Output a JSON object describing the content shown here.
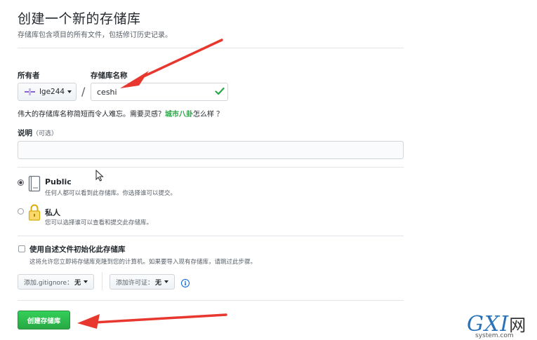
{
  "header": {
    "title": "创建一个新的存储库",
    "subtitle": "存储库包含项目的所有文件，包括修订历史记录。"
  },
  "owner": {
    "label": "所有者",
    "value": "lge244"
  },
  "repo_name": {
    "label": "存储库名称",
    "value": "ceshi",
    "slash": "/"
  },
  "hint": {
    "prefix": "伟大的存储库名称简短而令人难忘。需要灵感？",
    "suggestion": "城市八卦",
    "suffix": "怎么样 ？"
  },
  "description": {
    "label": "说明",
    "optional": "（可选）",
    "value": ""
  },
  "visibility": {
    "public": {
      "title": "Public",
      "desc": "任何人都可以看到此存储库。你选择谁可以提交。",
      "selected": true
    },
    "private": {
      "title": "私人",
      "desc": "您可以选择谁可以查看和提交此存储库。",
      "selected": false
    }
  },
  "init": {
    "label": "使用自述文件初始化此存储库",
    "desc": "这将允许您立即将存储库克隆到您的计算机。如果要导入现有存储库，请跳过此步骤。",
    "checked": false
  },
  "gitignore": {
    "label": "添加.gitignore：",
    "value": "无"
  },
  "license": {
    "label": "添加许可证：",
    "value": "无"
  },
  "submit": {
    "label": "创建存储库"
  },
  "watermark": {
    "brand": "GXI",
    "suffix": "网",
    "site": "system.com"
  },
  "colors": {
    "primary_green": "#28a745",
    "arrow_red": "#e8372f",
    "link_blue": "#0366d6"
  }
}
